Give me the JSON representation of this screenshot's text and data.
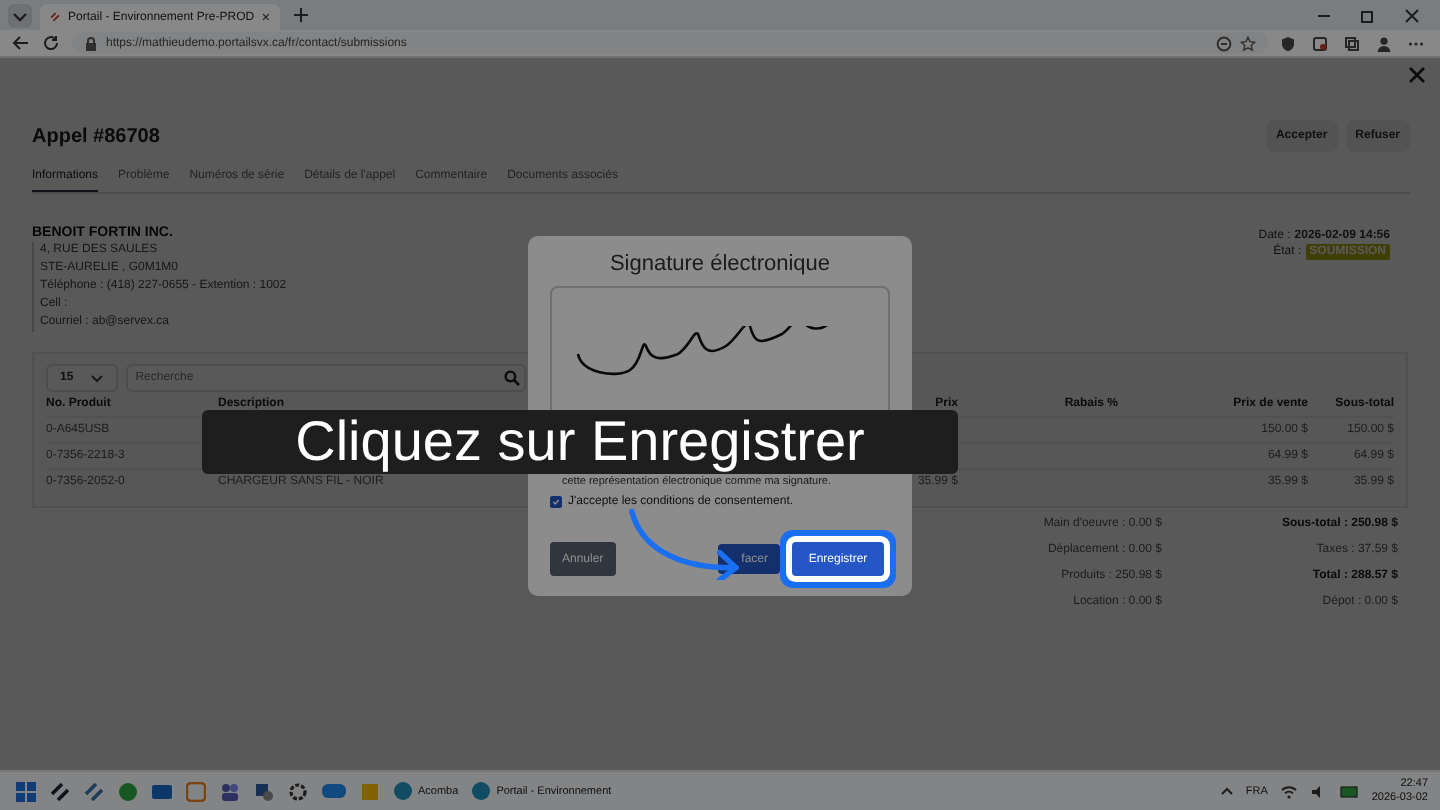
{
  "browser": {
    "tab_title": "Portail - Environnement Pre-PROD",
    "url": "https://mathieudemo.portailsvx.ca/fr/contact/submissions"
  },
  "page": {
    "title": "Appel #86708",
    "actions": [
      "Accepter",
      "Refuser"
    ],
    "tabs": [
      {
        "label": "Informations",
        "selected": true
      },
      {
        "label": "Problème",
        "selected": false
      },
      {
        "label": "Numéros de série",
        "selected": false
      },
      {
        "label": "Détails de l'appel",
        "selected": false
      },
      {
        "label": "Commentaire",
        "selected": false
      },
      {
        "label": "Documents associés",
        "selected": false
      }
    ],
    "customer": {
      "name": "BENOIT FORTIN INC.",
      "lines": [
        "4, RUE DES SAULES",
        "STE-AURELIE , G0M1M0",
        "Téléphone : (418) 227-0655 - Extention : 1002",
        "Cell :",
        "Courriel : ab@servex.ca"
      ]
    },
    "date": {
      "label": "Date :",
      "value": "2026-02-09 14:56"
    },
    "state": {
      "label": "État :",
      "value": "SOUMISSION"
    }
  },
  "table": {
    "page_size": "15",
    "search_placeholder": "Recherche",
    "columns": [
      "No. Produit",
      "Description",
      "Prix",
      "Rabais %",
      "Prix de vente",
      "Sous-total"
    ],
    "rows": [
      {
        "product": "0-A645USB",
        "sale_price": "150.00 $",
        "subtotal": "150.00 $"
      },
      {
        "product": "0-7356-2218-3",
        "sale_price": "64.99 $",
        "subtotal": "64.99 $"
      },
      {
        "product": "0-7356-2052-0",
        "description": "CHARGEUR SANS FIL - NOIR",
        "price": "35.99 $",
        "sale_price": "35.99 $",
        "subtotal": "35.99 $"
      }
    ]
  },
  "totals": {
    "left": [
      "Main d'oeuvre : 0.00 $",
      "Déplacement : 0.00 $",
      "Produits : 250.98 $",
      "Location : 0.00 $"
    ],
    "right": [
      {
        "text": "Sous-total : 250.98 $",
        "bold": true
      },
      {
        "text": "Taxes : 37.59 $",
        "bold": false
      },
      {
        "text": "Total : 288.57 $",
        "bold": true
      },
      {
        "text": "Dépot : 0.00 $",
        "bold": false
      }
    ]
  },
  "modal": {
    "title": "Signature électronique",
    "consent_text": "cette représentation électronique comme ma signature.",
    "checkbox": {
      "label": "J'accepte les conditions de consentement.",
      "checked": true
    },
    "buttons": [
      {
        "label": "Annuler",
        "kind": "secondary",
        "highlighted": false
      },
      {
        "label": "facer",
        "kind": "primary",
        "highlighted": false
      },
      {
        "label": "Enregistrer",
        "kind": "primary",
        "highlighted": true
      }
    ]
  },
  "caption": "Cliquez sur Enregistrer",
  "taskbar": {
    "apps": [
      {
        "label": "Acomba"
      },
      {
        "label": "Portail - Environnement"
      }
    ],
    "language": "FRA",
    "time": "22:47",
    "date": "2026-03-02"
  }
}
